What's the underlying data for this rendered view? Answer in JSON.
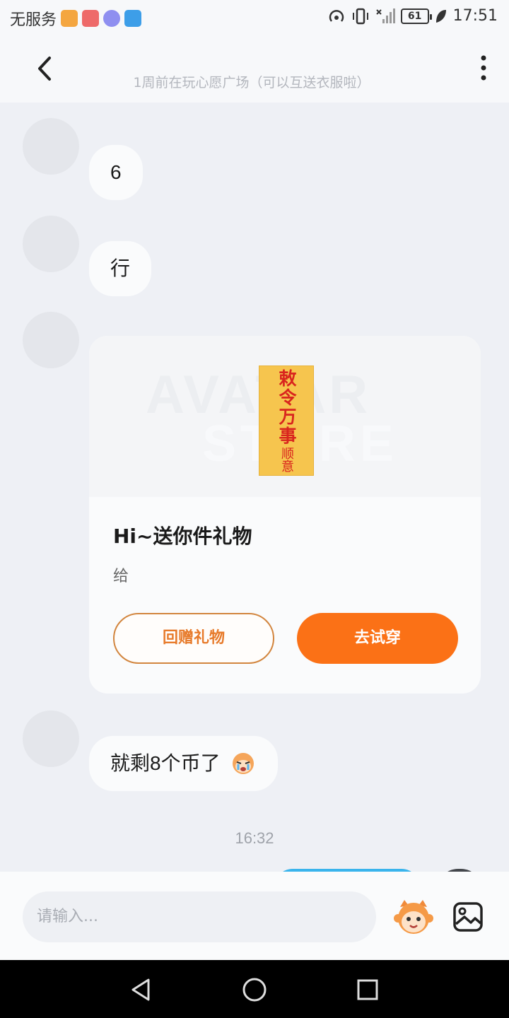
{
  "statusbar": {
    "carrier": "无服务",
    "battery": "61",
    "time": "17:51",
    "app_icons": [
      "video-app-icon",
      "red-app-icon",
      "music-app-icon",
      "shield-app-icon"
    ]
  },
  "header": {
    "subtitle": "1周前在玩心愿广场（可以互送衣服啦）"
  },
  "messages": [
    {
      "text": "6"
    },
    {
      "text": "行"
    },
    {
      "text": "就剩8个币了"
    }
  ],
  "gift_card": {
    "watermark": "AVATAR",
    "watermark2": "STORE",
    "talisman_main": "敕令万事",
    "talisman_sub": "顺意",
    "title": "Hi~送你件礼物",
    "description": "给",
    "return_gift_label": "回赠礼物",
    "try_on_label": "去试穿"
  },
  "timestamp": "16:32",
  "input": {
    "placeholder": "请输入..."
  },
  "colors": {
    "accent_orange": "#fb7116",
    "outline_orange": "#d2853e",
    "sent_bubble": "#3ab4ec",
    "background": "#eef0f5"
  }
}
